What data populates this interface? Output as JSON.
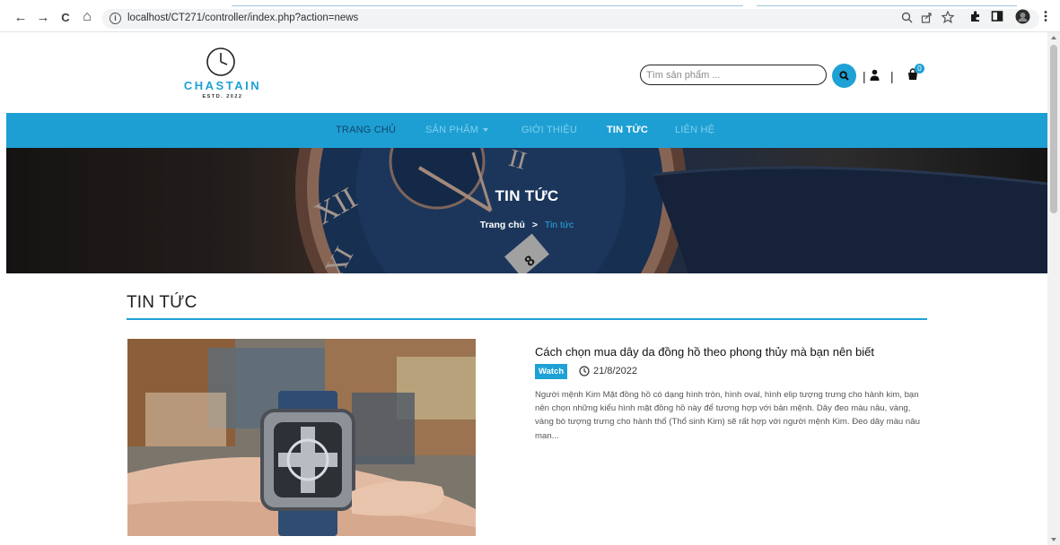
{
  "browser": {
    "url": "localhost/CT271/controller/index.php?action=news",
    "buttons": {
      "back": "←",
      "forward": "→",
      "reload": "C",
      "home": "⌂"
    }
  },
  "header": {
    "brand": "CHASTAIN",
    "estd": "ESTD. 2022",
    "search_placeholder": "Tìm sản phẩm ...",
    "separator": "|",
    "cart_count": "0"
  },
  "nav": {
    "items": [
      {
        "label": "TRANG CHỦ"
      },
      {
        "label": "SẢN PHẨM"
      },
      {
        "label": "GIỚI THIỆU"
      },
      {
        "label": "TIN TỨC"
      },
      {
        "label": "LIÊN HỆ"
      }
    ],
    "active": "TIN TỨC"
  },
  "hero": {
    "title": "TIN TỨC",
    "breadcrumb_home": "Trang chủ",
    "breadcrumb_sep": ">",
    "breadcrumb_current": "Tin tức"
  },
  "section": {
    "title": "TIN TỨC"
  },
  "post": {
    "title": "Cách chọn mua dây da đồng hồ theo phong thủy mà bạn nên biết",
    "tag": "Watch",
    "date": "21/8/2022",
    "excerpt": "Người mệnh Kim Mặt đồng hồ có dạng hình tròn, hình oval, hình elip tượng trưng cho hành kim, bạn nên chọn những kiểu hình mặt đồng hồ này để tương hợp với bản mệnh. Dây đeo màu nâu, vàng, vàng bò tượng trưng cho hành thổ (Thổ sinh Kim) sẽ rất hợp với người mệnh Kim. Đeo dây màu nâu man..."
  },
  "colors": {
    "accent": "#1ea1d5",
    "nav_bg": "#1e9fd3"
  }
}
